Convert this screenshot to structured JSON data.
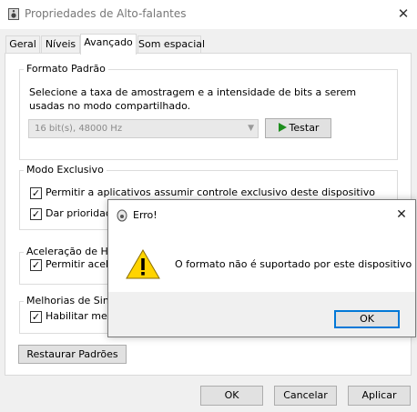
{
  "window": {
    "title": "Propriedades de Alto-falantes",
    "close_label": "✕"
  },
  "tabs": [
    {
      "label": "Geral",
      "active": false
    },
    {
      "label": "Níveis",
      "active": false
    },
    {
      "label": "Avançado",
      "active": true
    },
    {
      "label": "Som espacial",
      "active": false
    }
  ],
  "default_format": {
    "group_label": "Formato Padrão",
    "description_line1": "Selecione a taxa de amostragem e a intensidade de bits a serem",
    "description_line2": "usadas no modo compartilhado.",
    "selected_value": "16 bit(s), 48000 Hz",
    "test_label": "Testar"
  },
  "exclusive_mode": {
    "group_label": "Modo Exclusivo",
    "option1_label": "Permitir a aplicativos assumir controle exclusivo deste dispositivo",
    "option1_checked": true,
    "option2_label": "Dar prioridade",
    "option2_checked": true
  },
  "hardware_acceleration": {
    "group_label": "Aceleração de Ha",
    "option_label": "Permitir acele",
    "option_checked": true
  },
  "signal_enhancements": {
    "group_label": "Melhorias de Sina",
    "option_label": "Habilitar melh",
    "option_checked": true
  },
  "restore_defaults_label": "Restaurar Padrões",
  "footer": {
    "ok_label": "OK",
    "cancel_label": "Cancelar",
    "apply_label": "Aplicar"
  },
  "error_dialog": {
    "title": "Erro!",
    "close_label": "✕",
    "message": "O formato não é suportado por este dispositivo",
    "ok_label": "OK"
  },
  "colors": {
    "dialog_accent": "#0078d7",
    "warning_yellow": "#ffd400",
    "play_green": "#1e8e1e"
  }
}
